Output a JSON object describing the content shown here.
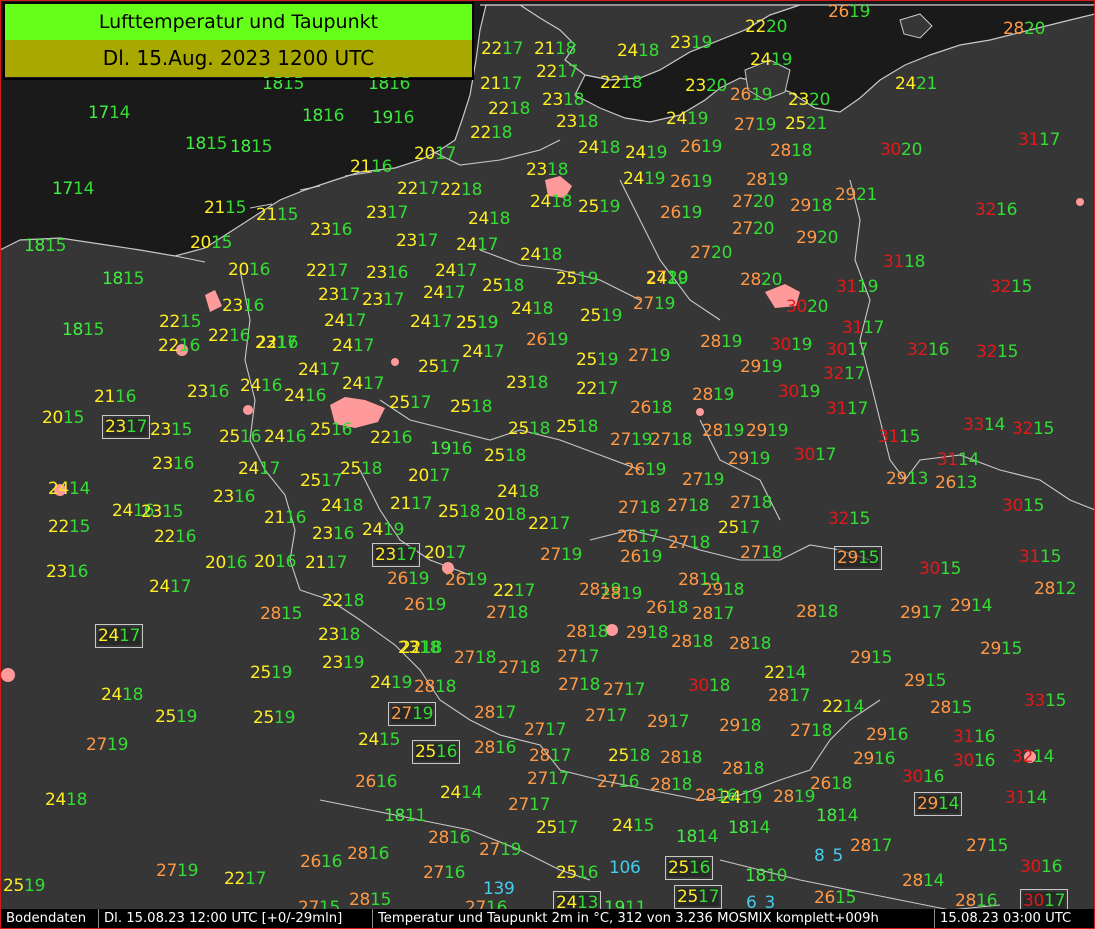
{
  "title": {
    "line1": "Lufttemperatur und Taupunkt",
    "line2": "Dl. 15.Aug. 2023 1200 UTC"
  },
  "colors": {
    "sea": "#1a1a1a",
    "land": "#363636",
    "border": "#c8c8c8",
    "city": "#ff9a9a",
    "title_bg": "#66ff1a",
    "subtitle_bg": "#a8a800",
    "dew": "#33dd33",
    "temp_band": {
      "14-19": "#44ee44",
      "20-25": "#ffee22",
      "26-29": "#ff9944",
      "30-35": "#e01a1a",
      "1-13": "#44ccee"
    }
  },
  "status_bar": {
    "source": "Bodendaten",
    "time": "Dl. 15.08.23 12:00 UTC [+0/-29mln]",
    "description": "Temperatur und Taupunkt 2m in °C, 312 von 3.236 MOSMIX komplett+009h",
    "run": "15.08.23 03:00 UTC"
  },
  "stations": [
    {
      "t": "26",
      "d": "19"
    },
    {
      "t": "22",
      "d": "20"
    },
    {
      "t": "28",
      "d": "20"
    },
    {
      "t": "15",
      "d": ""
    },
    {
      "t": "22",
      "d": "17"
    },
    {
      "t": "21",
      "d": "18"
    },
    {
      "t": "24",
      "d": "18"
    },
    {
      "t": "23",
      "d": "19"
    },
    {
      "t": "18",
      "d": "15"
    },
    {
      "t": "18",
      "d": "16"
    },
    {
      "t": "21",
      "d": "17"
    },
    {
      "t": "22",
      "d": "17"
    },
    {
      "t": "24",
      "d": "19"
    },
    {
      "t": "22",
      "d": "18"
    },
    {
      "t": "23",
      "d": "20"
    },
    {
      "t": "26",
      "d": "19"
    },
    {
      "t": "23",
      "d": "20"
    },
    {
      "t": "24",
      "d": "21"
    },
    {
      "t": "17",
      "d": "14"
    },
    {
      "t": "18",
      "d": "16"
    },
    {
      "t": "19",
      "d": "16"
    },
    {
      "t": "22",
      "d": "18"
    },
    {
      "t": "23",
      "d": "18"
    },
    {
      "t": "23",
      "d": "18"
    },
    {
      "t": "24",
      "d": "19"
    },
    {
      "t": "27",
      "d": "19"
    },
    {
      "t": "25",
      "d": "21"
    },
    {
      "t": "18",
      "d": "15"
    },
    {
      "t": "18",
      "d": "15"
    },
    {
      "t": "22",
      "d": "18"
    },
    {
      "t": "24",
      "d": "18"
    },
    {
      "t": "24",
      "d": "19"
    },
    {
      "t": "26",
      "d": "19"
    },
    {
      "t": "28",
      "d": "18"
    },
    {
      "t": "30",
      "d": "20"
    },
    {
      "t": "31",
      "d": "17"
    },
    {
      "t": "20",
      "d": "17"
    },
    {
      "t": "21",
      "d": "16"
    },
    {
      "t": "23",
      "d": "18"
    },
    {
      "t": "17",
      "d": "14"
    },
    {
      "t": "22",
      "d": "17"
    },
    {
      "t": "22",
      "d": "18"
    },
    {
      "t": "24",
      "d": "18"
    },
    {
      "t": "25",
      "d": "19"
    },
    {
      "t": "24",
      "d": "19"
    },
    {
      "t": "26",
      "d": "19"
    },
    {
      "t": "28",
      "d": "19"
    },
    {
      "t": "29",
      "d": "21"
    },
    {
      "t": "21",
      "d": "15"
    },
    {
      "t": "21",
      "d": "15"
    },
    {
      "t": "23",
      "d": "17"
    },
    {
      "t": "24",
      "d": "18"
    },
    {
      "t": "26",
      "d": "19"
    },
    {
      "t": "27",
      "d": "20"
    },
    {
      "t": "29",
      "d": "18"
    },
    {
      "t": "32",
      "d": "16"
    },
    {
      "t": "20",
      "d": "15"
    },
    {
      "t": "23",
      "d": "16"
    },
    {
      "t": "23",
      "d": "17"
    },
    {
      "t": "24",
      "d": "17"
    },
    {
      "t": "27",
      "d": "20"
    },
    {
      "t": "29",
      "d": "20"
    },
    {
      "t": "18",
      "d": "15"
    },
    {
      "t": "20",
      "d": "16"
    },
    {
      "t": "22",
      "d": "17"
    },
    {
      "t": "23",
      "d": "16"
    },
    {
      "t": "24",
      "d": "17"
    },
    {
      "t": "24",
      "d": "18"
    },
    {
      "t": "25",
      "d": "19"
    },
    {
      "t": "27",
      "d": "20"
    },
    {
      "t": "31",
      "d": "18"
    },
    {
      "t": "18",
      "d": "15"
    },
    {
      "t": "25",
      "d": "18"
    },
    {
      "t": "24",
      "d": "19"
    },
    {
      "t": "27",
      "d": "20"
    },
    {
      "t": "31",
      "d": "19"
    },
    {
      "t": "32",
      "d": "15"
    },
    {
      "t": "23",
      "d": "16"
    },
    {
      "t": "23",
      "d": "17"
    },
    {
      "t": "23",
      "d": "17"
    },
    {
      "t": "24",
      "d": "17"
    },
    {
      "t": "24",
      "d": "18"
    },
    {
      "t": "25",
      "d": "19"
    },
    {
      "t": "25",
      "d": "19"
    },
    {
      "t": "27",
      "d": "19"
    },
    {
      "t": "28",
      "d": "20"
    },
    {
      "t": "30",
      "d": "20"
    },
    {
      "t": "22",
      "d": "15"
    },
    {
      "t": "18",
      "d": "15"
    },
    {
      "t": "22",
      "d": "16"
    },
    {
      "t": "23",
      "d": "17"
    },
    {
      "t": "24",
      "d": "17"
    },
    {
      "t": "24",
      "d": "17"
    },
    {
      "t": "25",
      "d": "19"
    },
    {
      "t": "26",
      "d": "19"
    },
    {
      "t": "31",
      "d": "17"
    },
    {
      "t": "22",
      "d": "16"
    },
    {
      "t": "22",
      "d": "16"
    },
    {
      "t": "24",
      "d": "17"
    },
    {
      "t": "24",
      "d": "17"
    },
    {
      "t": "25",
      "d": "17"
    },
    {
      "t": "25",
      "d": "19"
    },
    {
      "t": "27",
      "d": "19"
    },
    {
      "t": "28",
      "d": "19"
    },
    {
      "t": "30",
      "d": "19"
    },
    {
      "t": "30",
      "d": "17"
    },
    {
      "t": "32",
      "d": "16"
    },
    {
      "t": "32",
      "d": "15"
    },
    {
      "t": "24",
      "d": "17"
    },
    {
      "t": "32",
      "d": "17"
    },
    {
      "t": "29",
      "d": "19"
    },
    {
      "t": "23",
      "d": "16"
    },
    {
      "t": "24",
      "d": "16"
    },
    {
      "t": "24",
      "d": "16"
    },
    {
      "t": "24",
      "d": "17"
    },
    {
      "t": "23",
      "d": "18"
    },
    {
      "t": "22",
      "d": "17"
    },
    {
      "t": "28",
      "d": "19"
    },
    {
      "t": "30",
      "d": "19"
    },
    {
      "t": "21",
      "d": "16"
    },
    {
      "t": "20",
      "d": "15"
    },
    {
      "t": "25",
      "d": "17"
    },
    {
      "t": "25",
      "d": "18"
    },
    {
      "t": "26",
      "d": "18"
    },
    {
      "t": "31",
      "d": "17"
    },
    {
      "t": "23",
      "d": "17"
    },
    {
      "t": "23",
      "d": "15"
    },
    {
      "t": "25",
      "d": "16"
    },
    {
      "t": "24",
      "d": "16"
    },
    {
      "t": "25",
      "d": "16"
    },
    {
      "t": "22",
      "d": "16"
    },
    {
      "t": "19",
      "d": "16"
    },
    {
      "t": "25",
      "d": "18"
    },
    {
      "t": "25",
      "d": "18"
    },
    {
      "t": "27",
      "d": "19"
    },
    {
      "t": "27",
      "d": "18"
    },
    {
      "t": "28",
      "d": "19"
    },
    {
      "t": "29",
      "d": "19"
    },
    {
      "t": "33",
      "d": "14"
    },
    {
      "t": "32",
      "d": "15"
    },
    {
      "t": "31",
      "d": "15"
    },
    {
      "t": "23",
      "d": "16"
    },
    {
      "t": "25",
      "d": "18"
    },
    {
      "t": "29",
      "d": "19"
    },
    {
      "t": "30",
      "d": "17"
    },
    {
      "t": "31",
      "d": "14"
    },
    {
      "t": "24",
      "d": "17"
    },
    {
      "t": "26",
      "d": "19"
    },
    {
      "t": "24",
      "d": "14"
    },
    {
      "t": "25",
      "d": "17"
    },
    {
      "t": "20",
      "d": "17"
    },
    {
      "t": "25",
      "d": "18"
    },
    {
      "t": "27",
      "d": "19"
    },
    {
      "t": "29",
      "d": "13"
    },
    {
      "t": "26",
      "d": "13"
    },
    {
      "t": "23",
      "d": "16"
    },
    {
      "t": "24",
      "d": "18"
    },
    {
      "t": "24",
      "d": "18"
    },
    {
      "t": "24",
      "d": "16"
    },
    {
      "t": "23",
      "d": "15"
    },
    {
      "t": "21",
      "d": "17"
    },
    {
      "t": "25",
      "d": "18"
    },
    {
      "t": "20",
      "d": "18"
    },
    {
      "t": "27",
      "d": "18"
    },
    {
      "t": "27",
      "d": "18"
    },
    {
      "t": "27",
      "d": "18"
    },
    {
      "t": "30",
      "d": "15"
    },
    {
      "t": "22",
      "d": "15"
    },
    {
      "t": "21",
      "d": "16"
    },
    {
      "t": "24",
      "d": "19"
    },
    {
      "t": "22",
      "d": "17"
    },
    {
      "t": "32",
      "d": "15"
    },
    {
      "t": "25",
      "d": "17"
    },
    {
      "t": "22",
      "d": "16"
    },
    {
      "t": "23",
      "d": "16"
    },
    {
      "t": "23",
      "d": "17"
    },
    {
      "t": "20",
      "d": "17"
    },
    {
      "t": "26",
      "d": "17"
    },
    {
      "t": "27",
      "d": "18"
    },
    {
      "t": "27",
      "d": "18"
    },
    {
      "t": "26",
      "d": "19"
    },
    {
      "t": "20",
      "d": "16"
    },
    {
      "t": "20",
      "d": "16"
    },
    {
      "t": "21",
      "d": "17"
    },
    {
      "t": "26",
      "d": "19"
    },
    {
      "t": "26",
      "d": "19"
    },
    {
      "t": "27",
      "d": "19"
    },
    {
      "t": "29",
      "d": "15"
    },
    {
      "t": "30",
      "d": "15"
    },
    {
      "t": "31",
      "d": "15"
    },
    {
      "t": "23",
      "d": "16"
    },
    {
      "t": "24",
      "d": "17"
    },
    {
      "t": "22",
      "d": "17"
    },
    {
      "t": "28",
      "d": "19"
    },
    {
      "t": "28",
      "d": "19"
    },
    {
      "t": "28",
      "d": "19"
    },
    {
      "t": "29",
      "d": "18"
    },
    {
      "t": "28",
      "d": "12"
    },
    {
      "t": "22",
      "d": "18"
    },
    {
      "t": "26",
      "d": "19"
    },
    {
      "t": "26",
      "d": "18"
    },
    {
      "t": "28",
      "d": "18"
    },
    {
      "t": "28",
      "d": "17"
    },
    {
      "t": "29",
      "d": "17"
    },
    {
      "t": "29",
      "d": "14"
    },
    {
      "t": "28",
      "d": "15"
    },
    {
      "t": "23",
      "d": "18"
    },
    {
      "t": "22",
      "d": "18"
    },
    {
      "t": "27",
      "d": "18"
    },
    {
      "t": "28",
      "d": "18"
    },
    {
      "t": "29",
      "d": "18"
    },
    {
      "t": "28",
      "d": "18"
    },
    {
      "t": "28",
      "d": "18"
    },
    {
      "t": "29",
      "d": "15"
    },
    {
      "t": "24",
      "d": "17"
    },
    {
      "t": "23",
      "d": "18"
    },
    {
      "t": "27",
      "d": "18"
    },
    {
      "t": "27",
      "d": "18"
    },
    {
      "t": "29",
      "d": "15"
    },
    {
      "t": "23",
      "d": "19"
    },
    {
      "t": "27",
      "d": "17"
    },
    {
      "t": "22",
      "d": "14"
    },
    {
      "t": "25",
      "d": "19"
    },
    {
      "t": "24",
      "d": "19"
    },
    {
      "t": "27",
      "d": "18"
    },
    {
      "t": "27",
      "d": "17"
    },
    {
      "t": "28",
      "d": "18"
    },
    {
      "t": "30",
      "d": "18"
    },
    {
      "t": "28",
      "d": "17"
    },
    {
      "t": "29",
      "d": "15"
    },
    {
      "t": "24",
      "d": "18"
    },
    {
      "t": "22",
      "d": "14"
    },
    {
      "t": "33",
      "d": "15"
    },
    {
      "t": "25",
      "d": "19"
    },
    {
      "t": "25",
      "d": "19"
    },
    {
      "t": "27",
      "d": "19"
    },
    {
      "t": "28",
      "d": "17"
    },
    {
      "t": "27",
      "d": "17"
    },
    {
      "t": "29",
      "d": "17"
    },
    {
      "t": "29",
      "d": "18"
    },
    {
      "t": "28",
      "d": "15"
    },
    {
      "t": "27",
      "d": "19"
    },
    {
      "t": "24",
      "d": "15"
    },
    {
      "t": "25",
      "d": "16"
    },
    {
      "t": "28",
      "d": "16"
    },
    {
      "t": "27",
      "d": "17"
    },
    {
      "t": "28",
      "d": "17"
    },
    {
      "t": "28",
      "d": "18"
    },
    {
      "t": "27",
      "d": "18"
    },
    {
      "t": "29",
      "d": "16"
    },
    {
      "t": "31",
      "d": "16"
    },
    {
      "t": "25",
      "d": "18"
    },
    {
      "t": "29",
      "d": "16"
    },
    {
      "t": "30",
      "d": "16"
    },
    {
      "t": "32",
      "d": "14"
    },
    {
      "t": "26",
      "d": "16"
    },
    {
      "t": "27",
      "d": "17"
    },
    {
      "t": "27",
      "d": "16"
    },
    {
      "t": "28",
      "d": "18"
    },
    {
      "t": "30",
      "d": "16"
    },
    {
      "t": "24",
      "d": "19"
    },
    {
      "t": "28",
      "d": "16"
    },
    {
      "t": "28",
      "d": "18"
    },
    {
      "t": "28",
      "d": "19"
    },
    {
      "t": "26",
      "d": "18"
    },
    {
      "t": "24",
      "d": "18"
    },
    {
      "t": "24",
      "d": "14"
    },
    {
      "t": "27",
      "d": "17"
    },
    {
      "t": "29",
      "d": "14"
    },
    {
      "t": "31",
      "d": "14"
    },
    {
      "t": "18",
      "d": "11"
    },
    {
      "t": "28",
      "d": "16"
    },
    {
      "t": "25",
      "d": "17"
    },
    {
      "t": "24",
      "d": "15"
    },
    {
      "t": "18",
      "d": "14"
    },
    {
      "t": "18",
      "d": "14"
    },
    {
      "t": "18",
      "d": "14"
    },
    {
      "t": "28",
      "d": "17"
    },
    {
      "t": "27",
      "d": "15"
    },
    {
      "t": "26",
      "d": "16"
    },
    {
      "t": "28",
      "d": "16"
    },
    {
      "t": "27",
      "d": "19"
    },
    {
      "t": "8",
      "d": "5"
    },
    {
      "t": "30",
      "d": "16"
    },
    {
      "t": "27",
      "d": "19"
    },
    {
      "t": "22",
      "d": "17"
    },
    {
      "t": "27",
      "d": "16"
    },
    {
      "t": "25",
      "d": "16"
    },
    {
      "t": "10",
      "d": "6"
    },
    {
      "t": "25",
      "d": "16"
    },
    {
      "t": "18",
      "d": "10"
    },
    {
      "t": "28",
      "d": "14"
    },
    {
      "t": "13",
      "d": "9"
    },
    {
      "t": "25",
      "d": "19"
    },
    {
      "t": "25",
      "d": "17"
    },
    {
      "t": "26",
      "d": "15"
    },
    {
      "t": "28",
      "d": "16"
    },
    {
      "t": "30",
      "d": "17"
    },
    {
      "t": "27",
      "d": "15"
    },
    {
      "t": "28",
      "d": "15"
    },
    {
      "t": "27",
      "d": "16"
    },
    {
      "t": "24",
      "d": "13"
    },
    {
      "t": "19",
      "d": "11"
    },
    {
      "t": "6",
      "d": "3"
    }
  ]
}
